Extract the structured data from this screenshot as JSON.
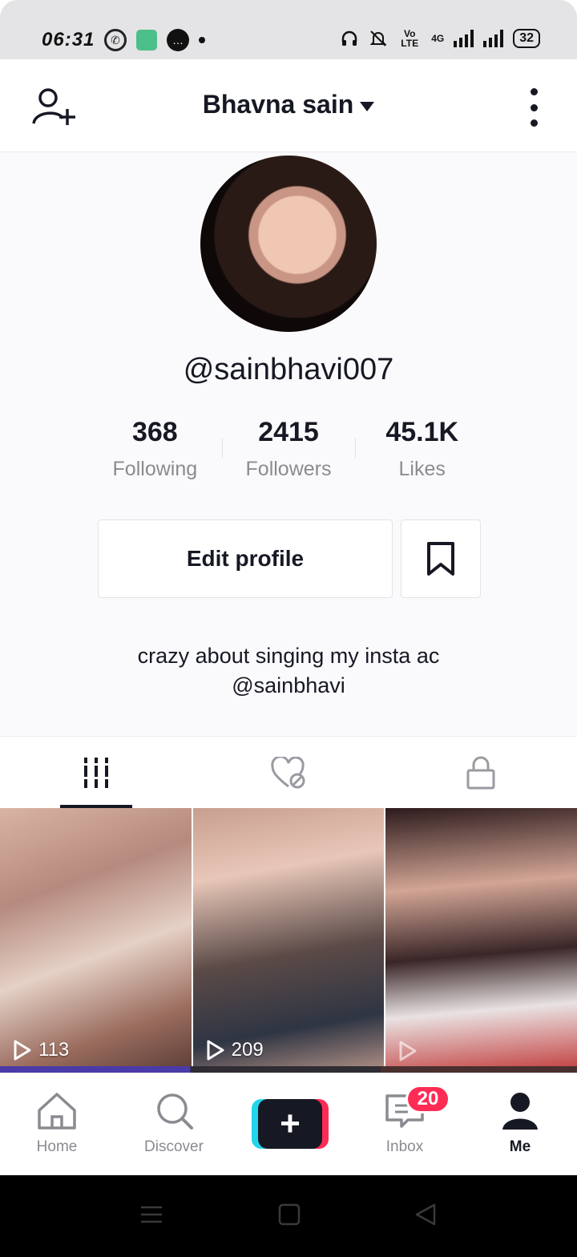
{
  "status_bar": {
    "time": "06:31",
    "network_label": "Vo LTE",
    "network_type": "4G",
    "battery": "32"
  },
  "header": {
    "title": "Bhavna sain"
  },
  "profile": {
    "username": "@sainbhavi007",
    "stats": [
      {
        "value": "368",
        "label": "Following"
      },
      {
        "value": "2415",
        "label": "Followers"
      },
      {
        "value": "45.1K",
        "label": "Likes"
      }
    ],
    "edit_button": "Edit profile",
    "bio_line1": "crazy about singing my insta ac",
    "bio_line2": "@sainbhavi"
  },
  "tabs": [
    {
      "icon": "videos-grid-icon",
      "active": true
    },
    {
      "icon": "liked-hidden-icon",
      "active": false
    },
    {
      "icon": "lock-icon",
      "active": false
    }
  ],
  "videos": [
    {
      "plays": "113"
    },
    {
      "plays": "209"
    },
    {
      "plays": ""
    }
  ],
  "bottom_nav": {
    "home": "Home",
    "discover": "Discover",
    "inbox": "Inbox",
    "inbox_badge": "20",
    "me": "Me"
  },
  "colors": {
    "accent_pink": "#fe2c55",
    "accent_cyan": "#20d5ec",
    "text_primary": "#161823",
    "text_secondary": "#8a8b91"
  }
}
